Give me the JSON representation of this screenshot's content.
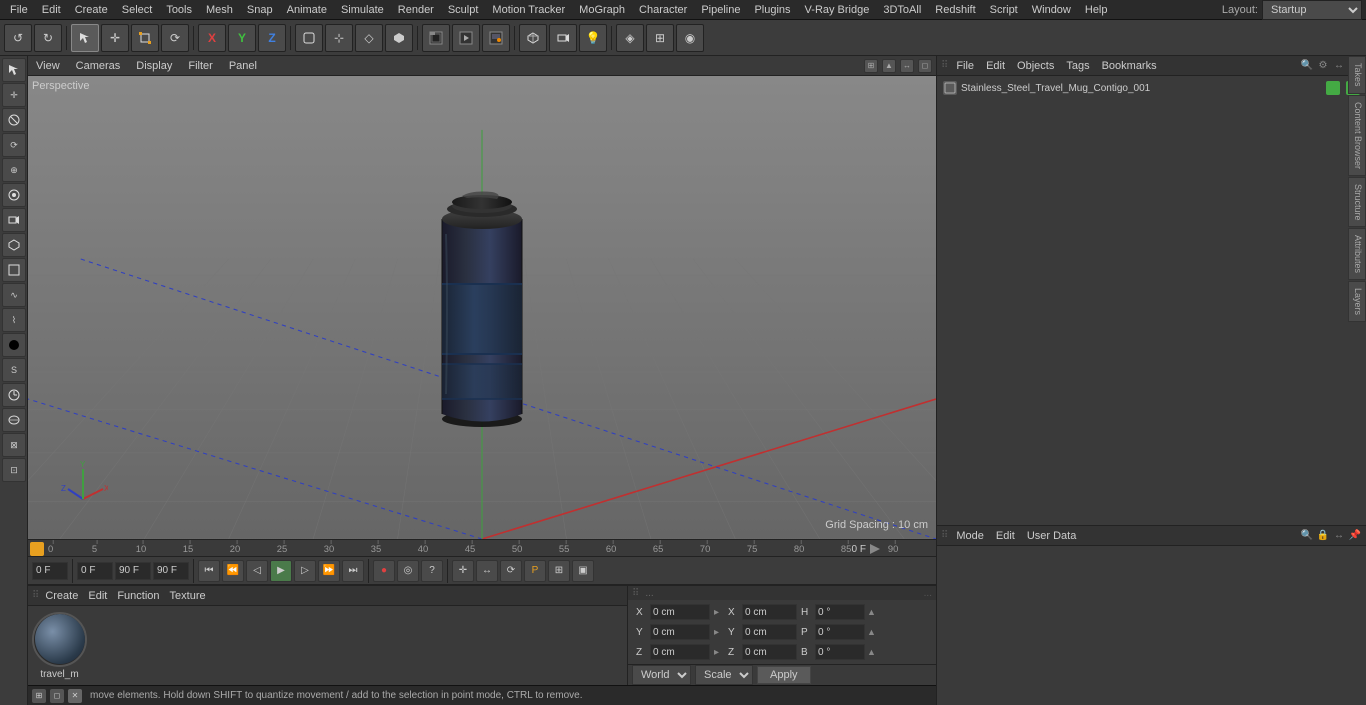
{
  "menu": {
    "items": [
      "File",
      "Edit",
      "Create",
      "Select",
      "Tools",
      "Mesh",
      "Snap",
      "Animate",
      "Simulate",
      "Render",
      "Sculpt",
      "Motion Tracker",
      "MoGraph",
      "Character",
      "Pipeline",
      "Plugins",
      "V-Ray Bridge",
      "3DToAll",
      "Redshift",
      "Script",
      "Window",
      "Help"
    ]
  },
  "toolbar": {
    "layout_label": "Layout:",
    "layout_value": "Startup",
    "buttons": [
      "↺",
      "⬜",
      "✛",
      "✦",
      "X",
      "Y",
      "Z",
      "◻",
      "⌾",
      "▶",
      "▣",
      "◈",
      "○",
      "□",
      "∿",
      "⊞",
      "▸",
      "⬡",
      "△",
      "⊙",
      "⊕",
      "⊚",
      "⊛",
      "⊜",
      "⊝",
      "⊞",
      "⊟",
      "⊠",
      "⊡"
    ]
  },
  "viewport": {
    "label": "Perspective",
    "menu_items": [
      "View",
      "Cameras",
      "Display",
      "Filter",
      "Panel"
    ],
    "grid_spacing": "Grid Spacing : 10 cm",
    "corner_buttons": [
      "⊞",
      "▲",
      "↔",
      "◻"
    ]
  },
  "timeline": {
    "markers": [
      "0",
      "5",
      "10",
      "15",
      "20",
      "25",
      "30",
      "35",
      "40",
      "45",
      "50",
      "55",
      "60",
      "65",
      "70",
      "75",
      "80",
      "85",
      "90"
    ],
    "current_frame": "0 F",
    "start_frame": "0 F",
    "end_frame": "90 F",
    "preview_end": "90 F"
  },
  "material": {
    "header_items": [
      "Create",
      "Edit",
      "Function",
      "Texture"
    ],
    "name": "travel_m"
  },
  "coordinates": {
    "header_dots": "...",
    "x_pos": "0 cm",
    "y_pos": "0 cm",
    "z_pos": "0 cm",
    "x_size": "0 cm",
    "y_size": "0 cm",
    "z_size": "0 cm",
    "h_rot": "0°",
    "p_rot": "0°",
    "b_rot": "0°"
  },
  "bottom_controls": {
    "world_label": "World",
    "scale_label": "Scale",
    "apply_label": "Apply"
  },
  "status": {
    "text": "move elements. Hold down SHIFT to quantize movement / add to the selection in point mode, CTRL to remove."
  },
  "right_panel": {
    "header_items": [
      "File",
      "Edit",
      "Objects",
      "Tags",
      "Bookmarks"
    ],
    "object_name": "Stainless_Steel_Travel_Mug_Contigo_001"
  },
  "attributes": {
    "header_items": [
      "Mode",
      "Edit",
      "User Data"
    ]
  },
  "side_tabs": [
    "Takes",
    "Content Browser",
    "Structure",
    "Attributes",
    "Layers"
  ]
}
